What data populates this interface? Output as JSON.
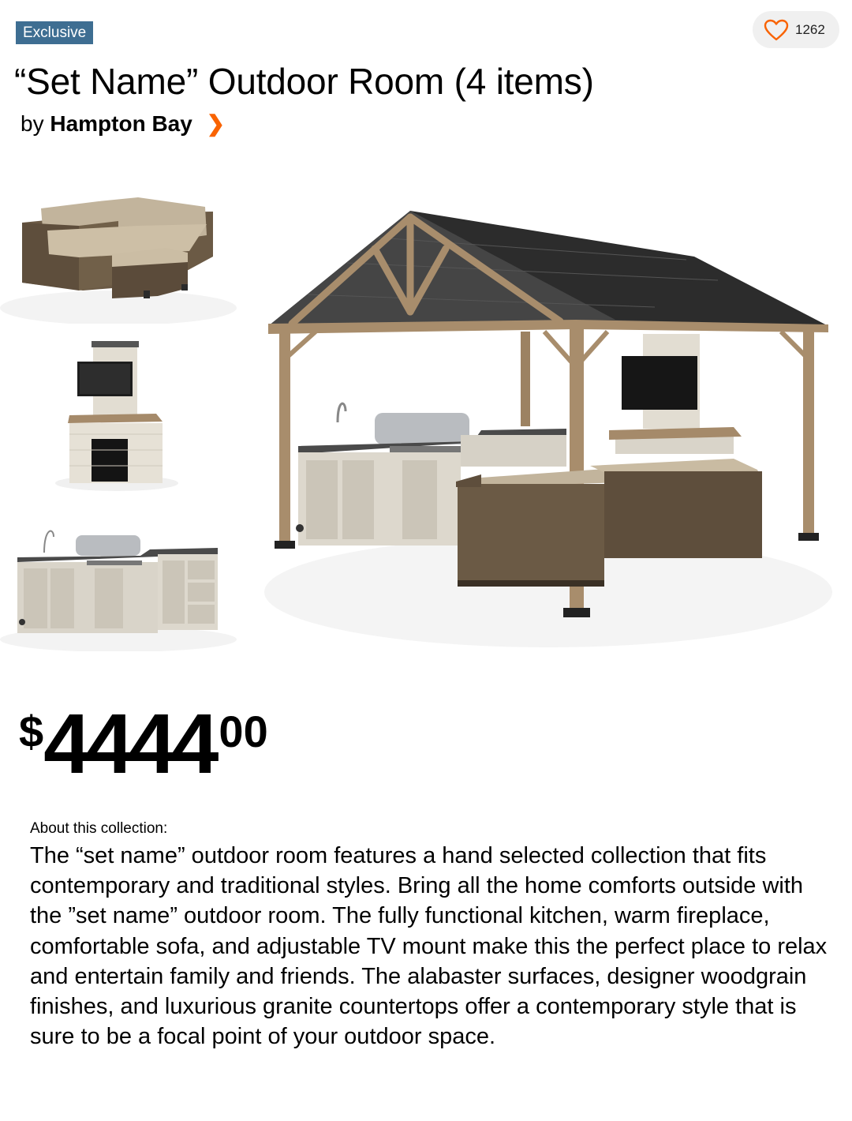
{
  "badge": {
    "label": "Exclusive"
  },
  "favorite": {
    "count": "1262",
    "icon": "heart-outline-icon",
    "color": "#f96302"
  },
  "product": {
    "title": "“Set Name” Outdoor Room (4 items)",
    "by_prefix": "by",
    "brand": "Hampton Bay",
    "brand_chevron": "❯"
  },
  "price": {
    "currency": "$",
    "whole": "4444",
    "cents": "00"
  },
  "about": {
    "label": "About this collection:",
    "text": "The “set name” outdoor room features a hand selected collection that fits contemporary and traditional styles.  Bring all the home comforts outside with the ”set name” outdoor room.  The fully functional kitchen, warm fireplace, comfortable sofa, and adjustable TV mount make this the perfect place to relax and entertain family and friends.  The alabaster surfaces, designer woodgrain finishes, and luxurious granite countertops offer a contemporary style that is sure to be a focal point of your outdoor space."
  },
  "colors": {
    "badge_bg": "#3e6e92",
    "accent": "#f96302"
  }
}
